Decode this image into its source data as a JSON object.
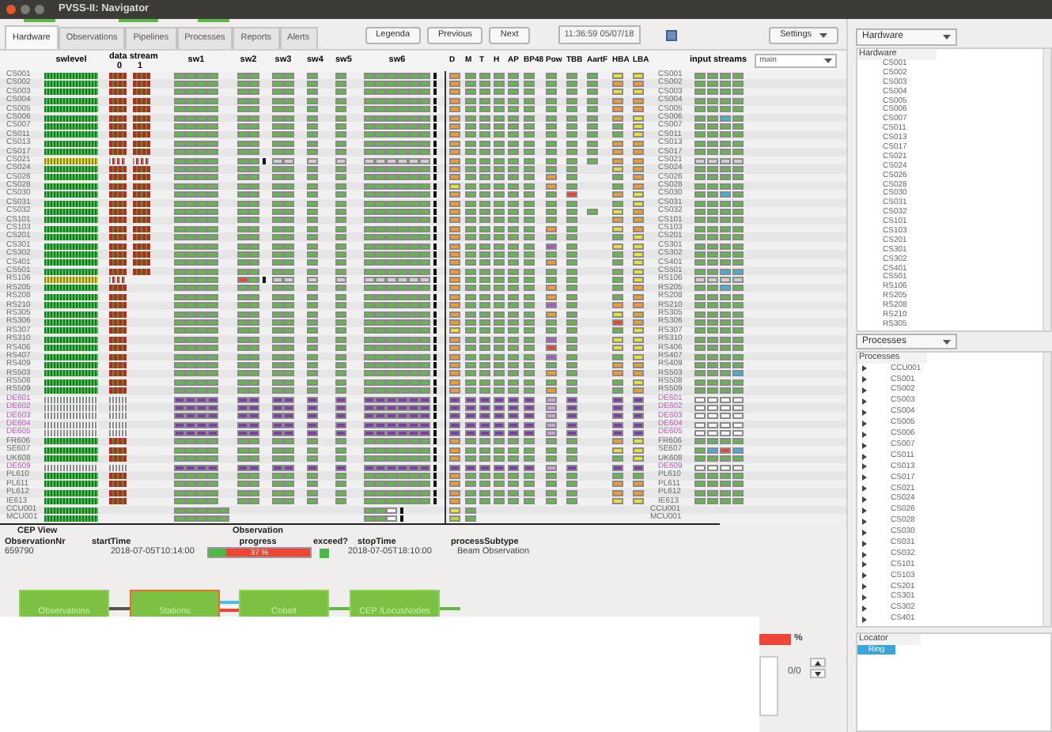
{
  "window": {
    "title": "PVSS-II: Navigator"
  },
  "tabs": [
    {
      "label": "Hardware",
      "selected": true
    },
    {
      "label": "Observations",
      "selected": false
    },
    {
      "label": "Pipelines",
      "selected": false
    },
    {
      "label": "Processes",
      "selected": false
    },
    {
      "label": "Reports",
      "selected": false
    },
    {
      "label": "Alerts",
      "selected": false
    }
  ],
  "buttons": [
    "Legenda",
    "Previous",
    "Next"
  ],
  "clock": "11:36:59 05/07/18",
  "settings": "Settings",
  "grid": {
    "headers": {
      "swlevel": "swlevel",
      "data_stream": "data stream",
      "stream_0": "0",
      "stream_1": "1",
      "sw": [
        "sw1",
        "sw2",
        "sw3",
        "sw4",
        "sw5",
        "sw6"
      ],
      "checks": [
        "D",
        "M",
        "T",
        "H",
        "AP",
        "BP48",
        "Pow",
        "TBB",
        "AartF",
        "HBA",
        "LBA"
      ],
      "input_streams": "input streams"
    },
    "stream_select": "main",
    "stations": [
      {
        "name": "CS001",
        "kind": "core",
        "hba": {
          "color": "#e6df3c"
        },
        "lba": {
          "color": "#e6df3c"
        },
        "aartf": true,
        "name_right": "CS001"
      },
      {
        "name": "CS002",
        "kind": "core",
        "hba": {
          "color": "#f39a2e"
        },
        "lba": {
          "color": "#f39a2e"
        },
        "aartf": true,
        "name_right": "CS002"
      },
      {
        "name": "CS003",
        "kind": "core",
        "hba": {
          "color": "#e6df3c"
        },
        "lba": {
          "color": "#e6df3c"
        },
        "aartf": true,
        "name_right": "CS003"
      },
      {
        "name": "CS004",
        "kind": "core",
        "hba": {
          "color": "#f39a2e"
        },
        "lba": {
          "color": "#f39a2e"
        },
        "aartf": true,
        "name_right": "CS004"
      },
      {
        "name": "CS005",
        "kind": "core",
        "hba": {
          "color": "#f39a2e"
        },
        "lba": {
          "color": "#f39a2e"
        },
        "aartf": true,
        "name_right": "CS005"
      },
      {
        "name": "CS006",
        "kind": "core",
        "hba": {
          "color": "#f39a2e"
        },
        "lba": {
          "color": "#e6df3c"
        },
        "aartf": true,
        "streams": [
          {
            "color": "#62b84a"
          },
          {
            "color": "#62b84a"
          },
          {
            "color": "#3ab4dc"
          },
          {
            "color": "#62b84a"
          }
        ],
        "name_right": "CS006"
      },
      {
        "name": "CS007",
        "kind": "core",
        "hba": {
          "color": "#62b84a"
        },
        "lba": {
          "color": "#e6df3c"
        },
        "aartf": true,
        "name_right": "CS007"
      },
      {
        "name": "CS011",
        "kind": "core",
        "hba": {
          "color": "#62b84a"
        },
        "lba": {
          "color": "#e6df3c"
        },
        "aartf": true,
        "name_right": "CS011"
      },
      {
        "name": "CS013",
        "kind": "core",
        "hba": {
          "color": "#f39a2e"
        },
        "lba": {
          "color": "#f39a2e"
        },
        "aartf": true,
        "name_right": "CS013"
      },
      {
        "name": "CS017",
        "kind": "core",
        "hba": {
          "color": "#f39a2e"
        },
        "lba": {
          "color": "#f39a2e"
        },
        "aartf": true,
        "name_right": "CS017"
      },
      {
        "name": "CS021",
        "kind": "core-off",
        "hba": {
          "color": "#f39a2e"
        },
        "lba": {
          "color": "#f39a2e"
        },
        "aartf": true,
        "name_right": "CS021"
      },
      {
        "name": "CS024",
        "kind": "core",
        "hba": {
          "color": "#e6df3c"
        },
        "lba": {
          "color": "#f39a2e"
        },
        "name_right": "CS024"
      },
      {
        "name": "CS026",
        "kind": "core",
        "pow": {
          "color": "#f39a2e"
        },
        "hba": {
          "color": "#62b84a"
        },
        "lba": {
          "color": "#f39a2e"
        },
        "name_right": "CS026"
      },
      {
        "name": "CS028",
        "kind": "core",
        "d": {
          "color": "#e6df3c"
        },
        "pow": {
          "color": "#f39a2e"
        },
        "hba": {
          "color": "#62b84a"
        },
        "lba": {
          "color": "#f39a2e"
        },
        "name_right": "CS028"
      },
      {
        "name": "CS030",
        "kind": "core",
        "tbb": {
          "color": "#e8442e"
        },
        "hba": {
          "color": "#f39a2e"
        },
        "lba": {
          "color": "#e6df3c"
        },
        "streams": [
          {
            "color": "#62b84a"
          },
          {
            "color": "#62b84a"
          },
          {
            "color": "#3ab4dc"
          },
          {
            "color": "#62b84a"
          }
        ],
        "name_right": "CS030"
      },
      {
        "name": "CS031",
        "kind": "core",
        "hba": {
          "color": "#62b84a"
        },
        "lba": {
          "color": "#e6df3c"
        },
        "name_right": "CS031"
      },
      {
        "name": "CS032",
        "kind": "core",
        "hba": {
          "color": "#e6df3c"
        },
        "lba": {
          "color": "#f39a2e"
        },
        "aartf": true,
        "name_right": "CS032"
      },
      {
        "name": "CS101",
        "kind": "core",
        "hba": {
          "color": "#f39a2e"
        },
        "lba": {
          "color": "#f39a2e"
        },
        "name_right": "CS101"
      },
      {
        "name": "CS103",
        "kind": "core",
        "pow": {
          "color": "#f39a2e"
        },
        "hba": {
          "color": "#e6df3c"
        },
        "lba": {
          "color": "#f39a2e"
        },
        "name_right": "CS103"
      },
      {
        "name": "CS201",
        "kind": "core",
        "hba": {
          "color": "#62b84a"
        },
        "lba": {
          "color": "#e6df3c"
        },
        "name_right": "CS201"
      },
      {
        "name": "CS301",
        "kind": "core",
        "pow": {
          "color": "#a45cc4"
        },
        "hba": {
          "color": "#e6df3c"
        },
        "lba": {
          "color": "#e6df3c"
        },
        "name_right": "CS301"
      },
      {
        "name": "CS302",
        "kind": "core",
        "hba": {
          "color": "#62b84a"
        },
        "lba": {
          "color": "#e6df3c"
        },
        "name_right": "CS302"
      },
      {
        "name": "CS401",
        "kind": "core",
        "pow": {
          "color": "#f39a2e"
        },
        "hba": {
          "color": "#62b84a"
        },
        "lba": {
          "color": "#e6df3c"
        },
        "name_right": "CS401"
      },
      {
        "name": "CS501",
        "kind": "core",
        "hba": {
          "color": "#62b84a"
        },
        "lba": {
          "color": "#e6df3c"
        },
        "streams": [
          {
            "color": "#62b84a"
          },
          {
            "color": "#62b84a"
          },
          {
            "color": "#3ab4dc"
          },
          {
            "color": "#3ab4dc"
          }
        ],
        "name_right": "CS501"
      },
      {
        "name": "RS106",
        "kind": "remote-off",
        "sw2": [
          {
            "color": "#e8442e"
          },
          {
            "color": "#62b84a"
          }
        ],
        "hba": {
          "color": "#62b84a"
        },
        "lba": {
          "color": "#e6df3c"
        },
        "name_right": "RS106"
      },
      {
        "name": "RS205",
        "kind": "remote",
        "pow": {
          "color": "#f39a2e"
        },
        "hba": {
          "color": "#62b84a"
        },
        "lba": {
          "color": "#f39a2e"
        },
        "streams": [
          {
            "color": "#62b84a"
          },
          {
            "color": "#62b84a"
          },
          {
            "color": "#3ab4dc"
          },
          {
            "color": "#62b84a"
          }
        ],
        "name_right": "RS205"
      },
      {
        "name": "RS208",
        "kind": "remote",
        "pow": {
          "color": "#f39a2e"
        },
        "hba": {
          "color": "#62b84a"
        },
        "lba": {
          "color": "#f39a2e"
        },
        "name_right": "RS208"
      },
      {
        "name": "RS210",
        "kind": "remote",
        "pow": {
          "color": "#a45cc4"
        },
        "hba": {
          "color": "#f39a2e"
        },
        "lba": {
          "color": "#f39a2e"
        },
        "name_right": "RS210"
      },
      {
        "name": "RS305",
        "kind": "remote",
        "pow": {
          "color": "#f39a2e"
        },
        "hba": {
          "color": "#e6df3c"
        },
        "lba": {
          "color": "#f39a2e"
        },
        "name_right": "RS305"
      },
      {
        "name": "RS306",
        "kind": "remote",
        "hba": {
          "color": "#e8442e"
        },
        "lba": {
          "color": "#f39a2e"
        },
        "name_right": "RS306"
      },
      {
        "name": "RS307",
        "kind": "remote",
        "d": {
          "color": "#e6df3c"
        },
        "hba": {
          "color": "#62b84a"
        },
        "lba": {
          "color": "#e6df3c"
        },
        "name_right": "RS307"
      },
      {
        "name": "RS310",
        "kind": "remote",
        "pow": {
          "color": "#a45cc4"
        },
        "hba": {
          "color": "#e6df3c"
        },
        "lba": {
          "color": "#e6df3c"
        },
        "name_right": "RS310"
      },
      {
        "name": "RS406",
        "kind": "remote",
        "pow": {
          "color": "#e8442e"
        },
        "hba": {
          "color": "#e6df3c"
        },
        "lba": {
          "color": "#e6df3c"
        },
        "name_right": "RS406"
      },
      {
        "name": "RS407",
        "kind": "remote",
        "pow": {
          "color": "#a45cc4"
        },
        "hba": {
          "color": "#62b84a"
        },
        "lba": {
          "color": "#e6df3c"
        },
        "name_right": "RS407"
      },
      {
        "name": "RS409",
        "kind": "remote",
        "hba": {
          "color": "#f39a2e"
        },
        "lba": {
          "color": "#f39a2e"
        },
        "name_right": "RS409"
      },
      {
        "name": "RS503",
        "kind": "remote",
        "pow": {
          "color": "#f39a2e"
        },
        "hba": {
          "color": "#f39a2e"
        },
        "lba": {
          "color": "#f39a2e"
        },
        "streams": [
          {
            "color": "#62b84a"
          },
          {
            "color": "#62b84a"
          },
          {
            "color": "#62b84a"
          },
          {
            "color": "#3ab4dc"
          }
        ],
        "name_right": "RS503"
      },
      {
        "name": "RS508",
        "kind": "remote",
        "hba": {
          "color": "#62b84a"
        },
        "lba": {
          "color": "#e6df3c"
        },
        "name_right": "RS508"
      },
      {
        "name": "RS509",
        "kind": "remote",
        "pow": {
          "color": "#f39a2e"
        },
        "hba": {
          "color": "#62b84a"
        },
        "lba": {
          "color": "#f39a2e"
        },
        "name_right": "RS509"
      },
      {
        "name": "DE601",
        "kind": "foreign",
        "name_right": "DE601"
      },
      {
        "name": "DE602",
        "kind": "foreign",
        "name_right": "DE602"
      },
      {
        "name": "DE603",
        "kind": "foreign",
        "name_right": "DE603"
      },
      {
        "name": "DE604",
        "kind": "foreign",
        "name_right": "DE604"
      },
      {
        "name": "DE605",
        "kind": "foreign",
        "name_right": "DE605"
      },
      {
        "name": "FR606",
        "kind": "remote",
        "hba": {
          "color": "#f39a2e"
        },
        "lba": {
          "color": "#e6df3c"
        },
        "name_right": "FR606"
      },
      {
        "name": "SE607",
        "kind": "remote",
        "hba": {
          "color": "#e6df3c"
        },
        "lba": {
          "color": "#e6df3c"
        },
        "streams": [
          {
            "color": "#62b84a"
          },
          {
            "color": "#3ab4dc"
          },
          {
            "color": "#e8442e"
          },
          {
            "color": "#3ab4dc"
          }
        ],
        "name_right": "SE607"
      },
      {
        "name": "UK608",
        "kind": "remote",
        "hba": {
          "color": "#62b84a"
        },
        "lba": {
          "color": "#e6df3c"
        },
        "name_right": "UK608"
      },
      {
        "name": "DE609",
        "kind": "foreign",
        "name_right": "DE609"
      },
      {
        "name": "PL610",
        "kind": "remote",
        "hba": {
          "color": "#62b84a"
        },
        "lba": {
          "color": "#62b84a"
        },
        "name_right": "PL610"
      },
      {
        "name": "PL611",
        "kind": "remote",
        "hba": {
          "color": "#f39a2e"
        },
        "lba": {
          "color": "#f39a2e"
        },
        "name_right": "PL611"
      },
      {
        "name": "PL612",
        "kind": "remote",
        "hba": {
          "color": "#f39a2e"
        },
        "lba": {
          "color": "#f39a2e"
        },
        "name_right": "PL612"
      },
      {
        "name": "IE613",
        "kind": "remote",
        "hba": {
          "color": "#e6df3c"
        },
        "lba": {
          "color": "#e6df3c"
        },
        "name_right": "IE613"
      },
      {
        "name": "CCU001",
        "kind": "unit",
        "d": {
          "color": "#e6df3c"
        },
        "name_right": "CCU001"
      },
      {
        "name": "MCU001",
        "kind": "unit",
        "d": {
          "color": "#b5d63a"
        },
        "name_right": "MCU001"
      }
    ]
  },
  "cep": {
    "title": "CEP View",
    "observation_nr": {
      "label": "ObservationNr",
      "value": "659790"
    },
    "start_time": {
      "label": "startTime",
      "value": "2018-07-05T10:14:00"
    },
    "progress": {
      "label": "Observation progress",
      "level": 0.17,
      "reading": "37 %"
    },
    "exceed": {
      "label": "exceed?",
      "on": false
    },
    "stop_time": {
      "label": "stopTime",
      "value": "2018-07-05T18:10:00"
    },
    "process_subtype": {
      "label": "processSubtype",
      "value": "Beam Observation"
    }
  },
  "pipeline": [
    {
      "label": "Observations",
      "alert": false
    },
    {
      "label": "Stations",
      "alert": true
    },
    {
      "label": "Cobalt",
      "alert": false
    },
    {
      "label": "CEP /LocusNodes",
      "alert": false
    }
  ],
  "bottom": {
    "unit": "%",
    "counter": "0/0"
  },
  "hardware_panel": {
    "select": "Hardware",
    "header": "Hardware",
    "items": [
      "CS001",
      "CS002",
      "CS003",
      "CS004",
      "CS005",
      "CS006",
      "CS007",
      "CS011",
      "CS013",
      "CS017",
      "CS021",
      "CS024",
      "CS026",
      "CS028",
      "CS030",
      "CS031",
      "CS032",
      "CS101",
      "CS103",
      "CS201",
      "CS301",
      "CS302",
      "CS401",
      "CS501",
      "RS106",
      "RS205",
      "RS208",
      "RS210",
      "RS305"
    ]
  },
  "processes_panel": {
    "select": "Processes",
    "header": "Processes",
    "items": [
      "CCU001",
      "CS001",
      "CS002",
      "CS003",
      "CS004",
      "CS005",
      "CS006",
      "CS007",
      "CS011",
      "CS013",
      "CS017",
      "CS021",
      "CS024",
      "CS026",
      "CS028",
      "CS030",
      "CS031",
      "CS032",
      "CS101",
      "CS103",
      "CS201",
      "CS301",
      "CS302",
      "CS401"
    ]
  },
  "locator": {
    "header": "Locator",
    "items": [
      {
        "label": "Ring",
        "selected": true
      }
    ]
  }
}
